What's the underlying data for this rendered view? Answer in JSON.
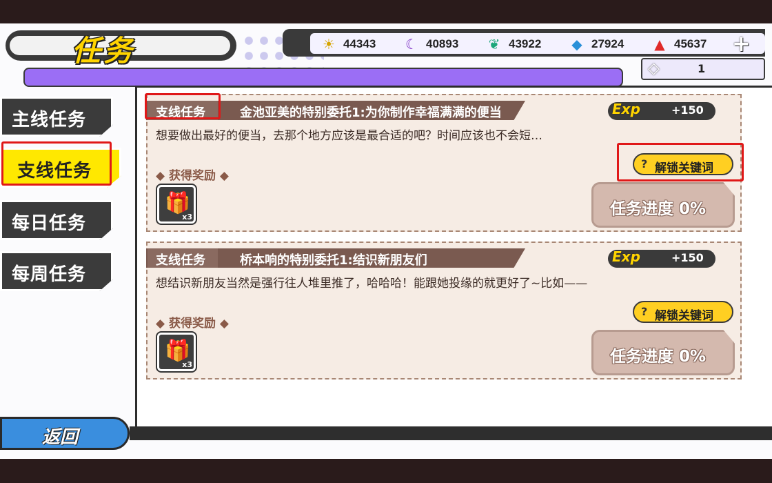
{
  "header": {
    "title": "任务"
  },
  "resources": [
    {
      "icon": "sun-icon",
      "glyph": "☀",
      "color": "#d6a400",
      "value": "44343"
    },
    {
      "icon": "moon-icon",
      "glyph": "☾",
      "color": "#7a2cc4",
      "value": "40893"
    },
    {
      "icon": "leaf-icon",
      "glyph": "❦",
      "color": "#1aa77a",
      "value": "43922"
    },
    {
      "icon": "water-drop-icon",
      "glyph": "💧",
      "color": "#2a90d8",
      "value": "27924"
    },
    {
      "icon": "flame-icon",
      "glyph": "🔥",
      "color": "#e02a2a",
      "value": "45637"
    }
  ],
  "plus_label": "+",
  "gems": {
    "value": "1"
  },
  "nav": [
    {
      "label": "主线任务"
    },
    {
      "label": "支线任务"
    },
    {
      "label": "每日任务"
    },
    {
      "label": "每周任务"
    }
  ],
  "quests": [
    {
      "type": "支线任务",
      "title": "金池亚美的特别委托1:为你制作幸福满满的便当",
      "exp_label": "Exp",
      "exp": "+150",
      "desc": "想要做出最好的便当，去那个地方应该是最合适的吧？时间应该也不会短…",
      "reward_label": "◆ 获得奖励 ◆",
      "reward_count": "x3",
      "unlock_label": "解锁关键词",
      "progress": "任务进度 0%"
    },
    {
      "type": "支线任务",
      "title": "桥本响的特别委托1:结识新朋友们",
      "exp_label": "Exp",
      "exp": "+150",
      "desc": "想结识新朋友当然是强行往人堆里推了，哈哈哈！能跟她投缘的就更好了~比如——",
      "reward_label": "◆ 获得奖励 ◆",
      "reward_count": "x3",
      "unlock_label": "解锁关键词",
      "progress": "任务进度 0%"
    }
  ],
  "back_label": "返回"
}
